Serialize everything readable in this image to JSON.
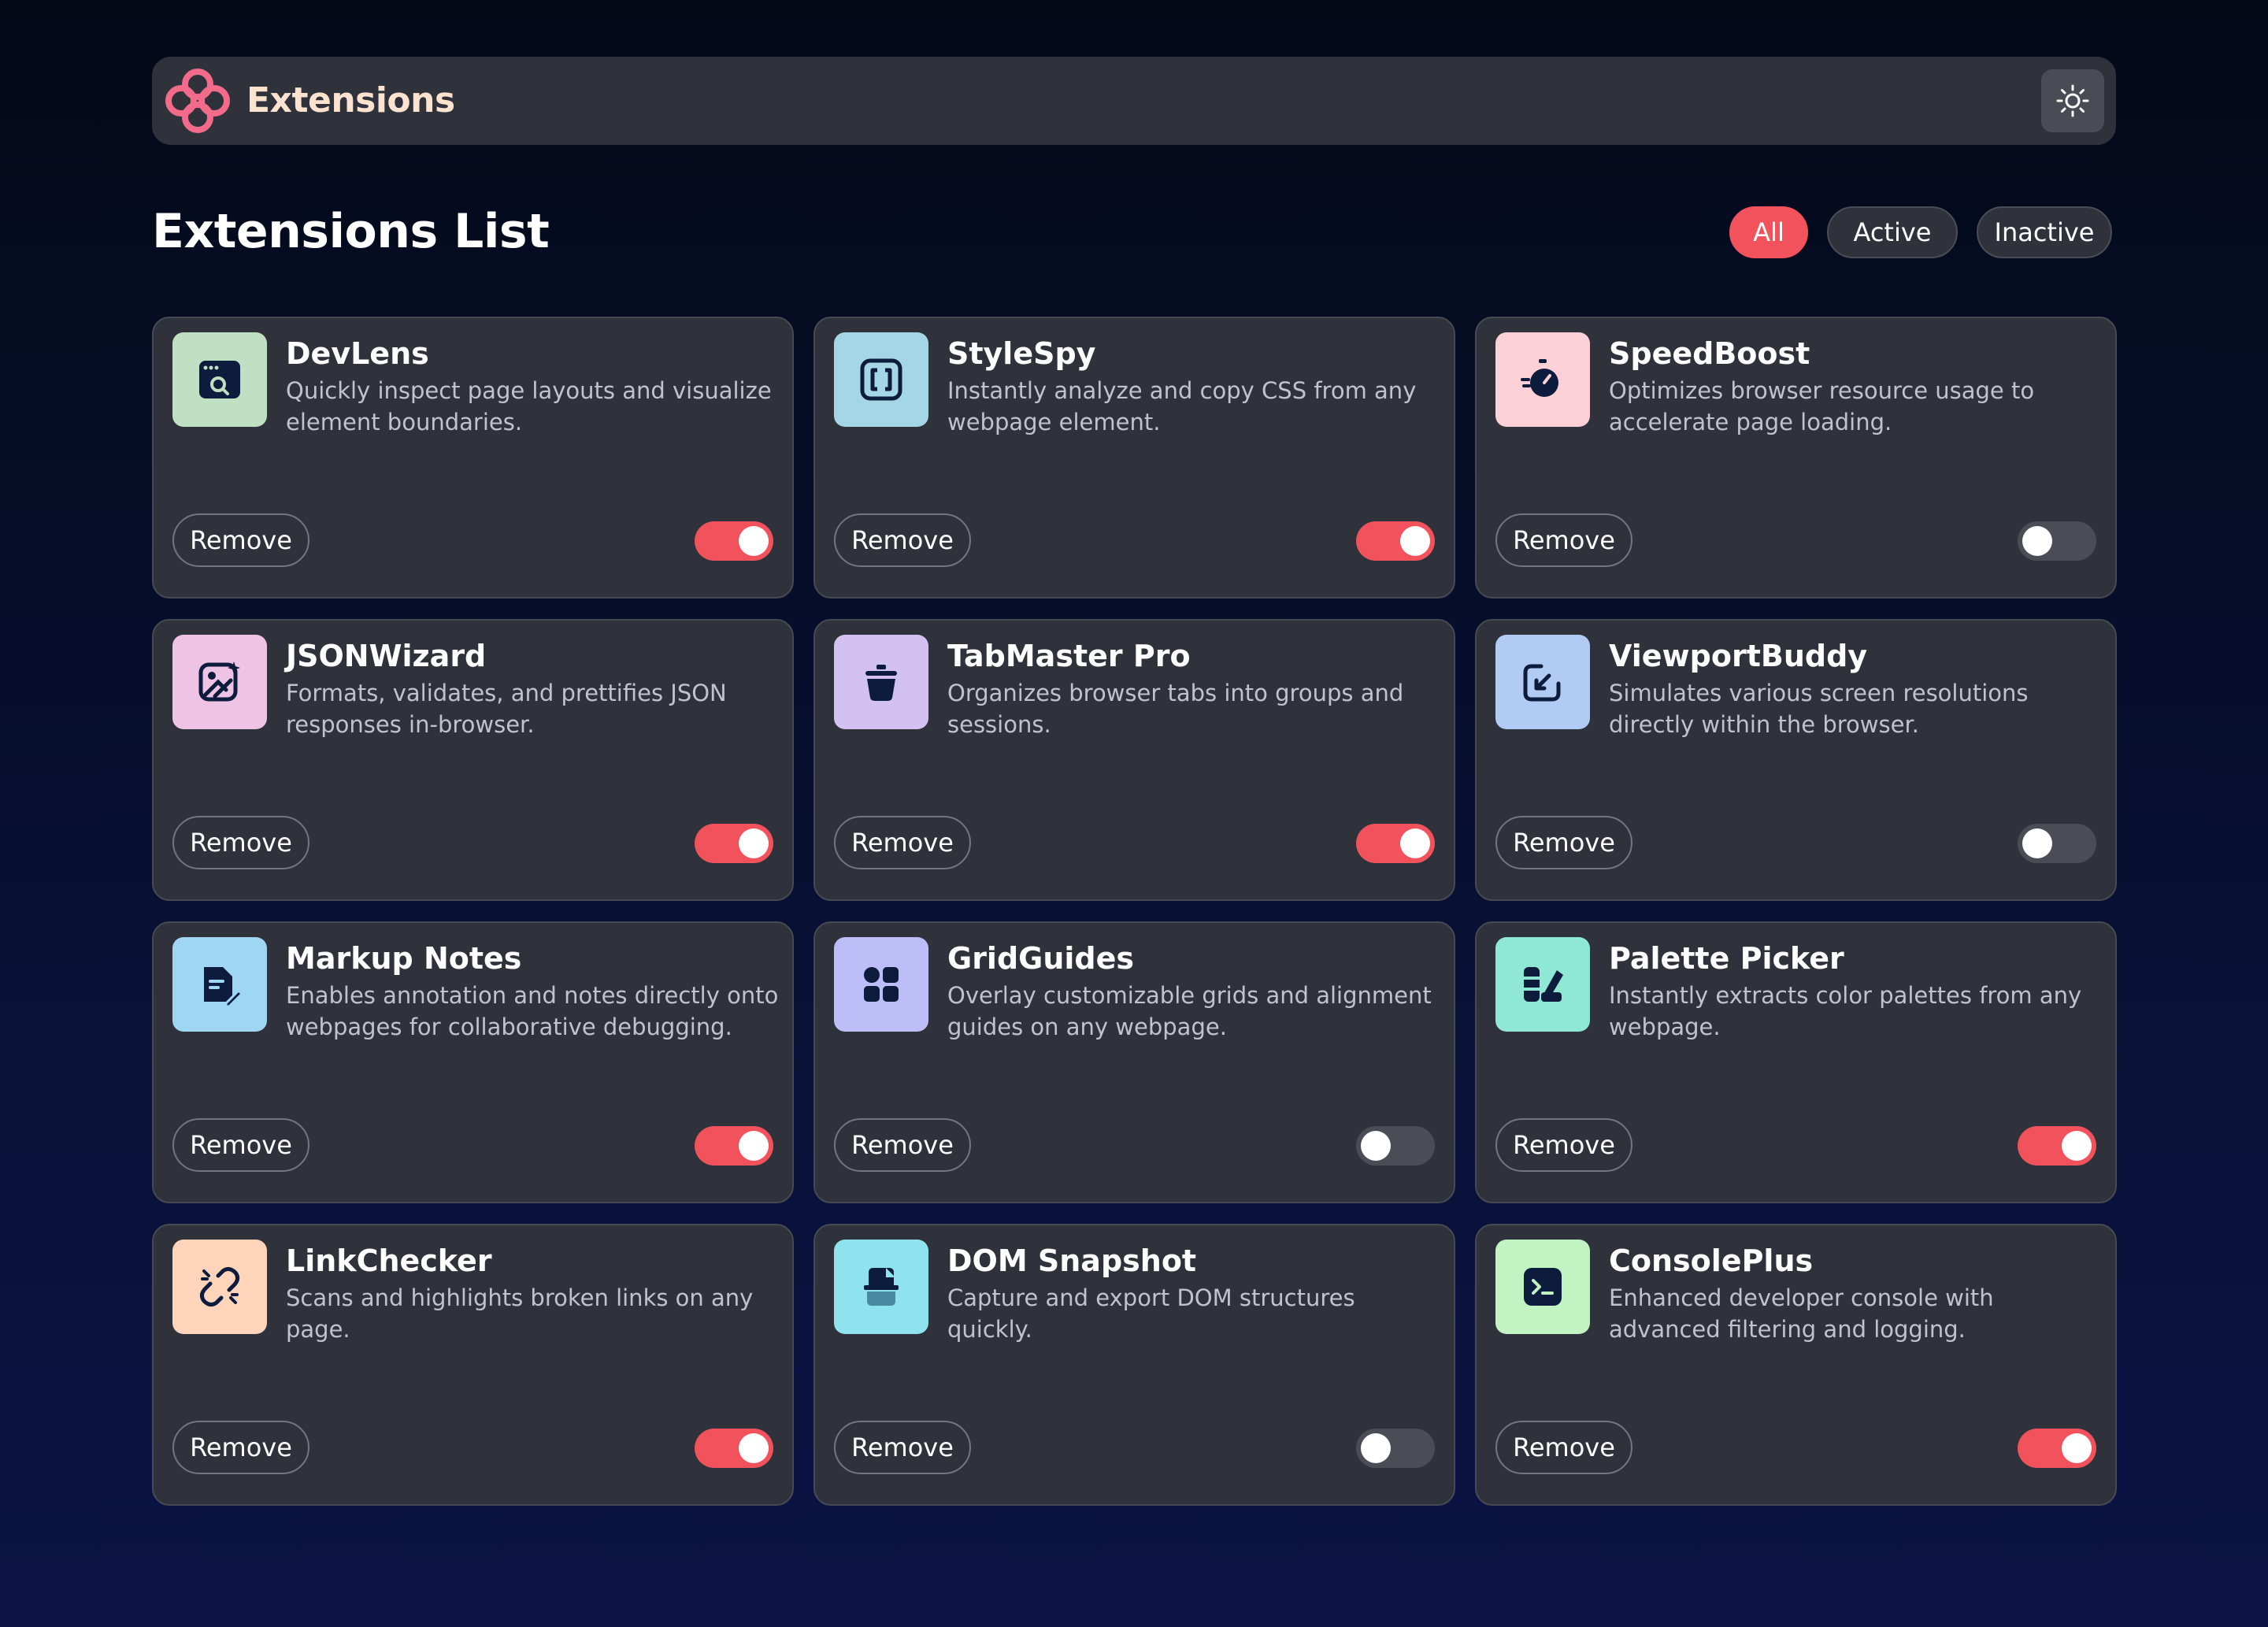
{
  "header": {
    "brand": "Extensions",
    "logo_icon": "extensions-logo-icon",
    "theme_icon": "sun-icon",
    "colors": {
      "logo": "#f26b8a",
      "brand_text": "#fbe3cf",
      "bar": "#2f323b"
    }
  },
  "main": {
    "title": "Extensions List",
    "filters": [
      {
        "label": "All",
        "active": true
      },
      {
        "label": "Active",
        "active": false
      },
      {
        "label": "Inactive",
        "active": false
      }
    ]
  },
  "colors": {
    "accent": "#f2525b",
    "card": "#2f323b",
    "toggle_off": "#4a4d56"
  },
  "extensions": [
    {
      "name": "DevLens",
      "description": "Quickly inspect page layouts and visualize element boundaries.",
      "icon": "browser-search-icon",
      "icon_bg": "#bfe0c3",
      "remove_label": "Remove",
      "enabled": true
    },
    {
      "name": "StyleSpy",
      "description": "Instantly analyze and copy CSS from any webpage element.",
      "icon": "brackets-icon",
      "icon_bg": "#a5d6e5",
      "remove_label": "Remove",
      "enabled": true
    },
    {
      "name": "SpeedBoost",
      "description": "Optimizes browser resource usage to accelerate page loading.",
      "icon": "stopwatch-icon",
      "icon_bg": "#fbd0d6",
      "remove_label": "Remove",
      "enabled": false
    },
    {
      "name": "JSONWizard",
      "description": "Formats, validates, and prettifies JSON responses in-browser.",
      "icon": "magic-image-icon",
      "icon_bg": "#efc3e6",
      "remove_label": "Remove",
      "enabled": true
    },
    {
      "name": "TabMaster Pro",
      "description": "Organizes browser tabs into groups and sessions.",
      "icon": "pot-icon",
      "icon_bg": "#d3c1f2",
      "remove_label": "Remove",
      "enabled": true
    },
    {
      "name": "ViewportBuddy",
      "description": "Simulates various screen resolutions directly within the browser.",
      "icon": "expand-arrow-icon",
      "icon_bg": "#b1cbf4",
      "remove_label": "Remove",
      "enabled": false
    },
    {
      "name": "Markup Notes",
      "description": "Enables annotation and notes directly onto webpages for collaborative debugging.",
      "icon": "note-pen-icon",
      "icon_bg": "#9fd6f4",
      "remove_label": "Remove",
      "enabled": true
    },
    {
      "name": "GridGuides",
      "description": "Overlay customizable grids and alignment guides on any webpage.",
      "icon": "grid-icon",
      "icon_bg": "#bdbdf8",
      "remove_label": "Remove",
      "enabled": false
    },
    {
      "name": "Palette Picker",
      "description": "Instantly extracts color palettes from any webpage.",
      "icon": "palette-icon",
      "icon_bg": "#8ee8d3",
      "remove_label": "Remove",
      "enabled": true
    },
    {
      "name": "LinkChecker",
      "description": "Scans and highlights broken links on any page.",
      "icon": "broken-link-icon",
      "icon_bg": "#fed5bb",
      "remove_label": "Remove",
      "enabled": true
    },
    {
      "name": "DOM Snapshot",
      "description": "Capture and export DOM structures quickly.",
      "icon": "snapshot-icon",
      "icon_bg": "#8fe3ef",
      "remove_label": "Remove",
      "enabled": false
    },
    {
      "name": "ConsolePlus",
      "description": "Enhanced developer console with advanced filtering and logging.",
      "icon": "terminal-icon",
      "icon_bg": "#c1f3c3",
      "remove_label": "Remove",
      "enabled": true
    }
  ]
}
